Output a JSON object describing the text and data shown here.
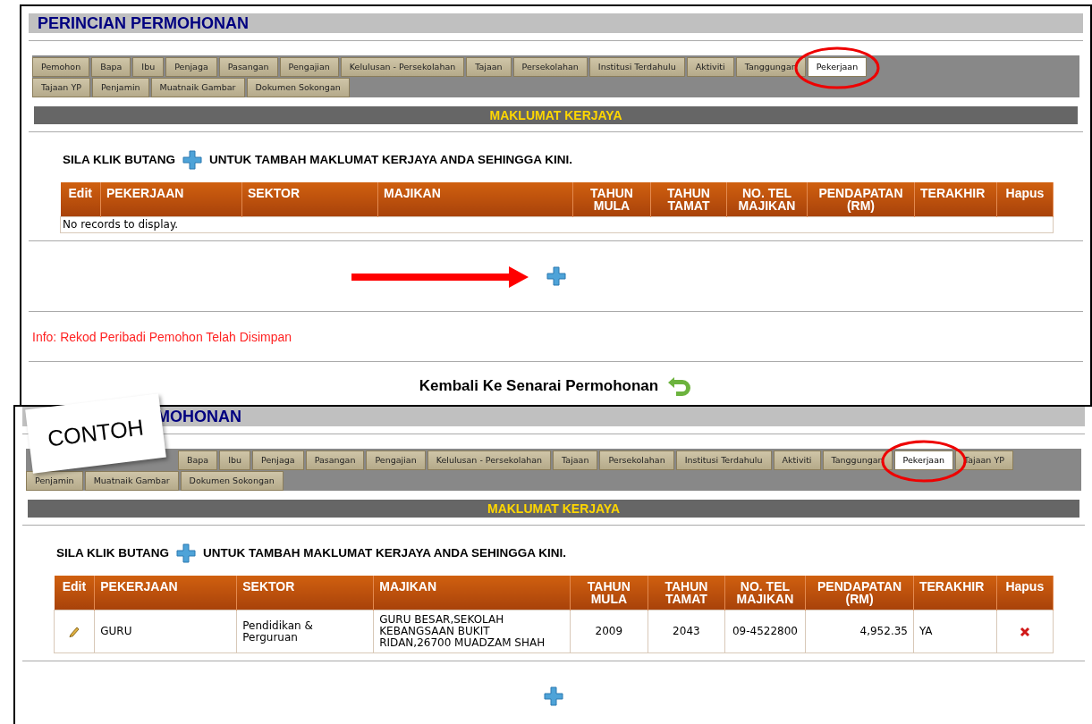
{
  "panels": [
    {
      "title": "PERINCIAN PERMOHONAN",
      "circle_selected_tab": true,
      "tab_rows": [
        [
          {
            "label": "Pemohon",
            "selected": false
          },
          {
            "label": "Bapa",
            "selected": false
          },
          {
            "label": "Ibu",
            "selected": false
          },
          {
            "label": "Penjaga",
            "selected": false
          },
          {
            "label": "Pasangan",
            "selected": false
          },
          {
            "label": "Pengajian",
            "selected": false
          },
          {
            "label": "Kelulusan - Persekolahan",
            "selected": false
          },
          {
            "label": "Tajaan",
            "selected": false
          },
          {
            "label": "Persekolahan",
            "selected": false
          },
          {
            "label": "Institusi Terdahulu",
            "selected": false
          },
          {
            "label": "Aktiviti",
            "selected": false
          },
          {
            "label": "Tanggungan",
            "selected": false
          },
          {
            "label": "Pekerjaan",
            "selected": true
          }
        ],
        [
          {
            "label": "Tajaan YP",
            "selected": false
          },
          {
            "label": "Penjamin",
            "selected": false
          },
          {
            "label": "Muatnaik Gambar",
            "selected": false
          },
          {
            "label": "Dokumen Sokongan",
            "selected": false
          }
        ]
      ],
      "section_title": "MAKLUMAT KERJAYA",
      "instruction_before": "SILA KLIK BUTANG",
      "instruction_after": "UNTUK TAMBAH MAKLUMAT KERJAYA ANDA SEHINGGA KINI.",
      "columns": [
        "Edit",
        "PEKERJAAN",
        "SEKTOR",
        "MAJIKAN",
        "TAHUN MULA",
        "TAHUN TAMAT",
        "NO. TEL MAJIKAN",
        "PENDAPATAN (RM)",
        "TERAKHIR",
        "Hapus"
      ],
      "empty_message": "No records to display.",
      "arrow_to_add": true,
      "info": "Info: Rekod Peribadi Pemohon Telah Disimpan",
      "back_link": "Kembali Ke Senarai Permohonan"
    },
    {
      "title": "MOHONAN",
      "sticker": "CONTOH",
      "circle_selected_tab": true,
      "tab_rows": [
        [
          {
            "label": "Bapa",
            "selected": false
          },
          {
            "label": "Ibu",
            "selected": false
          },
          {
            "label": "Penjaga",
            "selected": false
          },
          {
            "label": "Pasangan",
            "selected": false
          },
          {
            "label": "Pengajian",
            "selected": false
          },
          {
            "label": "Kelulusan - Persekolahan",
            "selected": false
          },
          {
            "label": "Tajaan",
            "selected": false
          },
          {
            "label": "Persekolahan",
            "selected": false
          },
          {
            "label": "Institusi Terdahulu",
            "selected": false
          },
          {
            "label": "Aktiviti",
            "selected": false
          },
          {
            "label": "Tanggungan",
            "selected": false
          },
          {
            "label": "Pekerjaan",
            "selected": true
          },
          {
            "label": "Tajaan YP",
            "selected": false
          }
        ],
        [
          {
            "label": "Penjamin",
            "selected": false
          },
          {
            "label": "Muatnaik Gambar",
            "selected": false
          },
          {
            "label": "Dokumen Sokongan",
            "selected": false
          }
        ]
      ],
      "section_title": "MAKLUMAT KERJAYA",
      "instruction_before": "SILA KLIK BUTANG",
      "instruction_after": "UNTUK TAMBAH MAKLUMAT KERJAYA ANDA SEHINGGA KINI.",
      "columns": [
        "Edit",
        "PEKERJAAN",
        "SEKTOR",
        "MAJIKAN",
        "TAHUN MULA",
        "TAHUN TAMAT",
        "NO. TEL MAJIKAN",
        "PENDAPATAN (RM)",
        "TERAKHIR",
        "Hapus"
      ],
      "rows": [
        {
          "pekerjaan": "GURU",
          "sektor": "Pendidikan & Perguruan",
          "majikan": "GURU BESAR,SEKOLAH KEBANGSAAN BUKIT RIDAN,26700 MUADZAM SHAH",
          "tahun_mula": "2009",
          "tahun_tamat": "2043",
          "no_tel": "09-4522800",
          "pendapatan": "4,952.35",
          "terakhir": "YA"
        }
      ]
    }
  ]
}
